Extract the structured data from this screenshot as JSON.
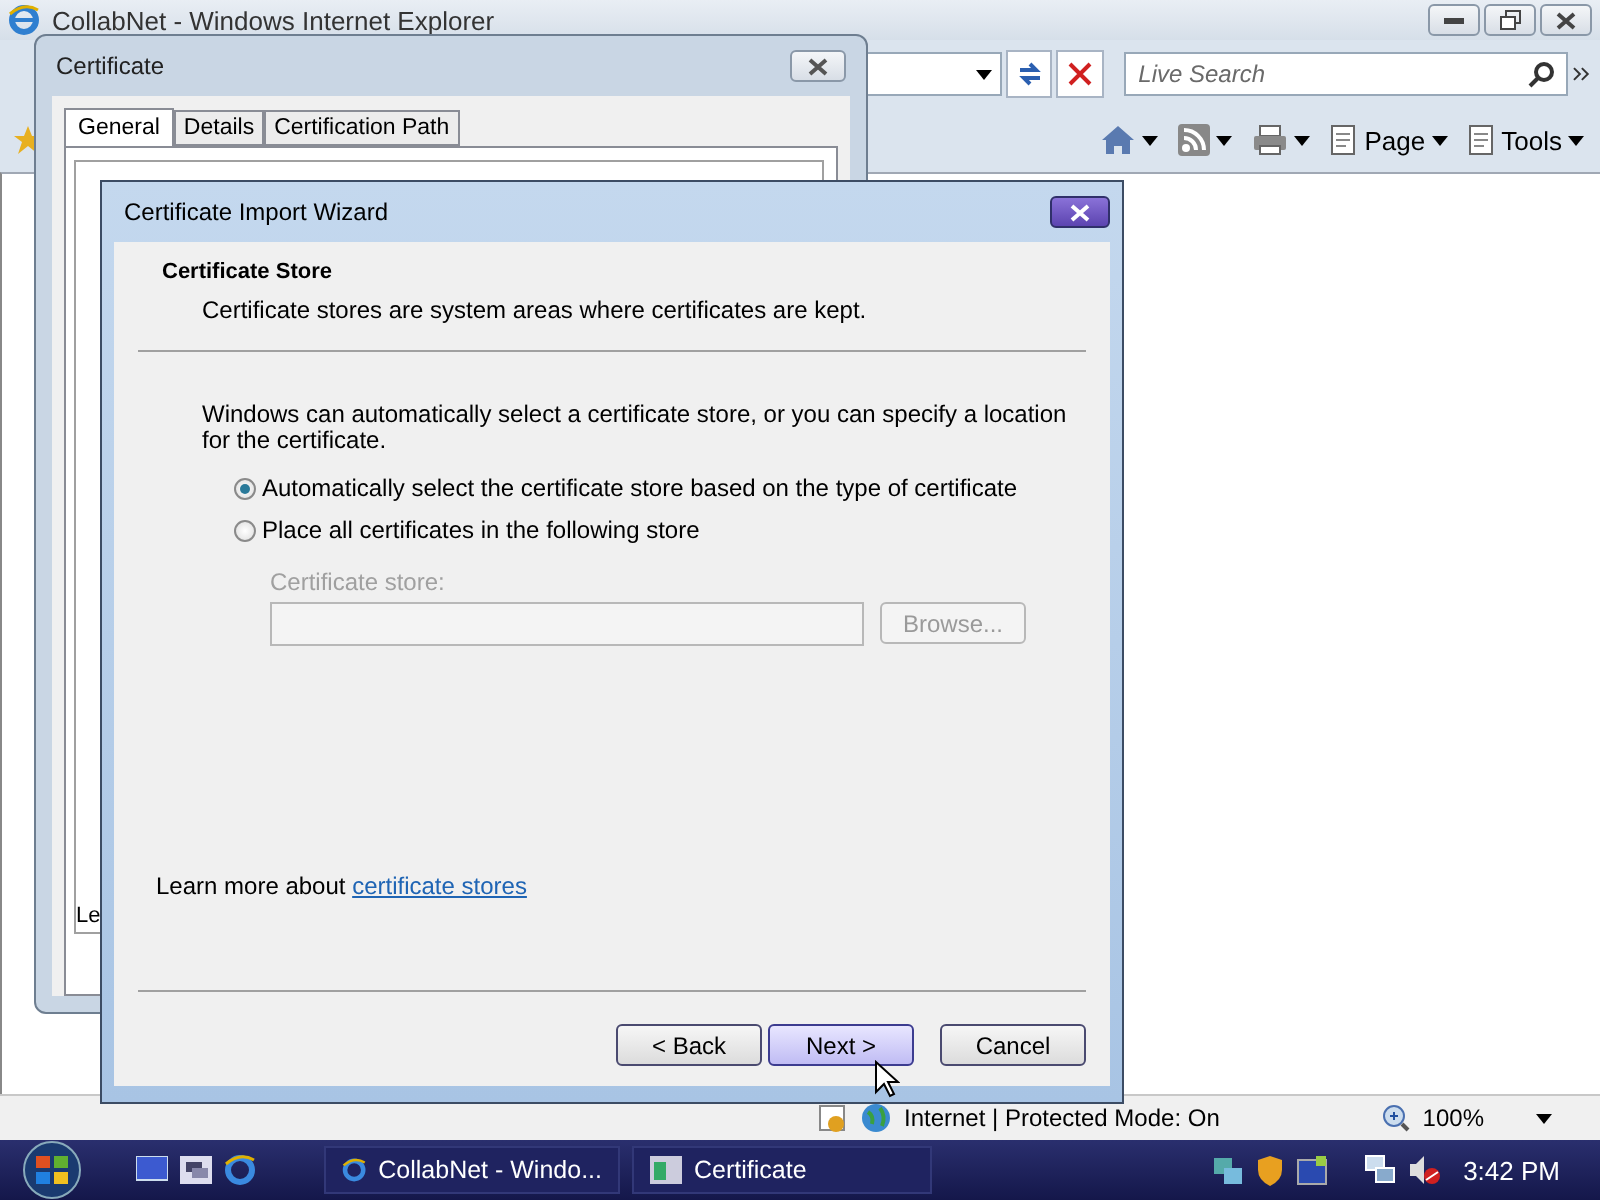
{
  "browser": {
    "title": "CollabNet - Windows Internet Explorer",
    "search": {
      "placeholder": "Live Search"
    },
    "command_bar": [
      {
        "kind": "home"
      },
      {
        "kind": "feed"
      },
      {
        "kind": "print"
      },
      {
        "kind": "menu",
        "label": "Page"
      },
      {
        "kind": "menu",
        "label": "Tools"
      }
    ],
    "status": {
      "zone": "Internet | Protected Mode: On",
      "zoom": "100%"
    }
  },
  "certificate_dialog": {
    "title": "Certificate",
    "tabs": [
      {
        "label": "General",
        "selected": true
      },
      {
        "label": "Details",
        "selected": false
      },
      {
        "label": "Certification Path",
        "selected": false
      }
    ],
    "clipped_text": "Le"
  },
  "wizard": {
    "title": "Certificate Import Wizard",
    "heading": "Certificate Store",
    "subheading": "Certificate stores are system areas where certificates are kept.",
    "intro": "Windows can automatically select a certificate store, or you can specify a location for the certificate.",
    "options": [
      {
        "label": "Automatically select the certificate store based on the type of certificate",
        "selected": true
      },
      {
        "label": "Place all certificates in the following store",
        "selected": false
      }
    ],
    "store_field": {
      "label": "Certificate store:",
      "disabled": true
    },
    "browse_button": {
      "label": "Browse...",
      "disabled": true
    },
    "learn_more": {
      "text": "Learn more about",
      "link": "certificate stores"
    },
    "buttons": [
      {
        "label": "< Back",
        "highlighted": false
      },
      {
        "label": "Next >",
        "highlighted": true
      },
      {
        "label": "Cancel",
        "highlighted": false
      }
    ]
  },
  "taskbar": {
    "tasks": [
      {
        "kind": "browser",
        "label": "CollabNet - Windo..."
      },
      {
        "kind": "dialog",
        "label": "Certificate"
      }
    ],
    "clock": "3:42 PM"
  }
}
